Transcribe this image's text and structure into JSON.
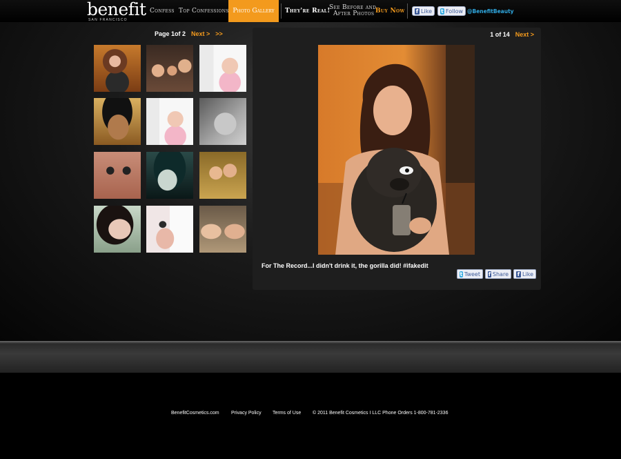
{
  "header": {
    "logo": "benefit",
    "logo_sub": "SAN FRANCISCO",
    "nav": {
      "confess": "Confess",
      "top_confessions": "Top Confessions",
      "photo_gallery": "Photo Gallery",
      "theyre_real": "They're Real!",
      "before_after_1": "See Before and",
      "before_after_2": "After Photos",
      "buy_now": "Buy Now"
    },
    "fb_like": "Like",
    "tw_follow": "Follow",
    "twitter_handle": "@BenefitBeauty"
  },
  "gallery": {
    "page_label": "Page 1of 2",
    "next": "Next >",
    "last": ">>"
  },
  "viewer": {
    "counter": "1 of 14",
    "next": "Next >",
    "caption": "For The Record...I didn't drink it, the gorilla did! #ifakedit",
    "tweet": "Tweet",
    "share": "Share",
    "like": "Like"
  },
  "footer": {
    "site": "BenefitCosmetics.com",
    "privacy": "Privacy Policy",
    "terms": "Terms of Use",
    "copyright": "© 2011 Benefit Cosmetics I LLC Phone Orders 1-800-781-2336"
  },
  "colors": {
    "accent": "#f39a1d",
    "facebook": "#3b5998",
    "twitter_link": "#2fa8e0"
  }
}
